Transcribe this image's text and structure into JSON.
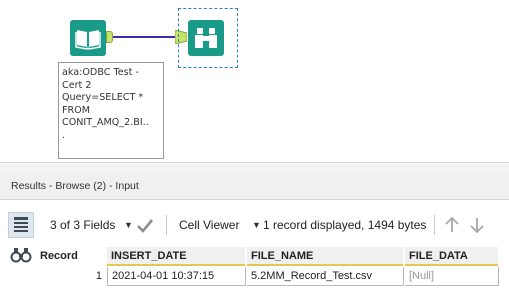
{
  "workflow": {
    "annotation_lines": [
      "aka:ODBC Test -",
      "Cert 2",
      "Query=SELECT *",
      "FROM",
      "CONIT_AMQ_2.BI..",
      "."
    ],
    "tool_color": "#1a9b8a",
    "connection_color": "#3b2ea8",
    "icons": {
      "input_tool": "open-book-icon",
      "browse_tool": "binoculars-icon"
    }
  },
  "results": {
    "title": "Results - Browse (2) - Input",
    "toolbar": {
      "fields_label": "3 of 3 Fields",
      "viewer_label": "Cell Viewer",
      "status_text": "1 record displayed, 1494 bytes"
    },
    "columns": [
      {
        "name": "Record"
      },
      {
        "name": "INSERT_DATE",
        "color": "#e6c84a"
      },
      {
        "name": "FILE_NAME",
        "color": "#e6c84a"
      },
      {
        "name": "FILE_DATA",
        "color": "#e6c84a"
      }
    ],
    "rows": [
      {
        "record": "1",
        "insert_date": "2021-04-01 10:37:15",
        "file_name": "5.2MM_Record_Test.csv",
        "file_data": "[Null]"
      }
    ]
  }
}
